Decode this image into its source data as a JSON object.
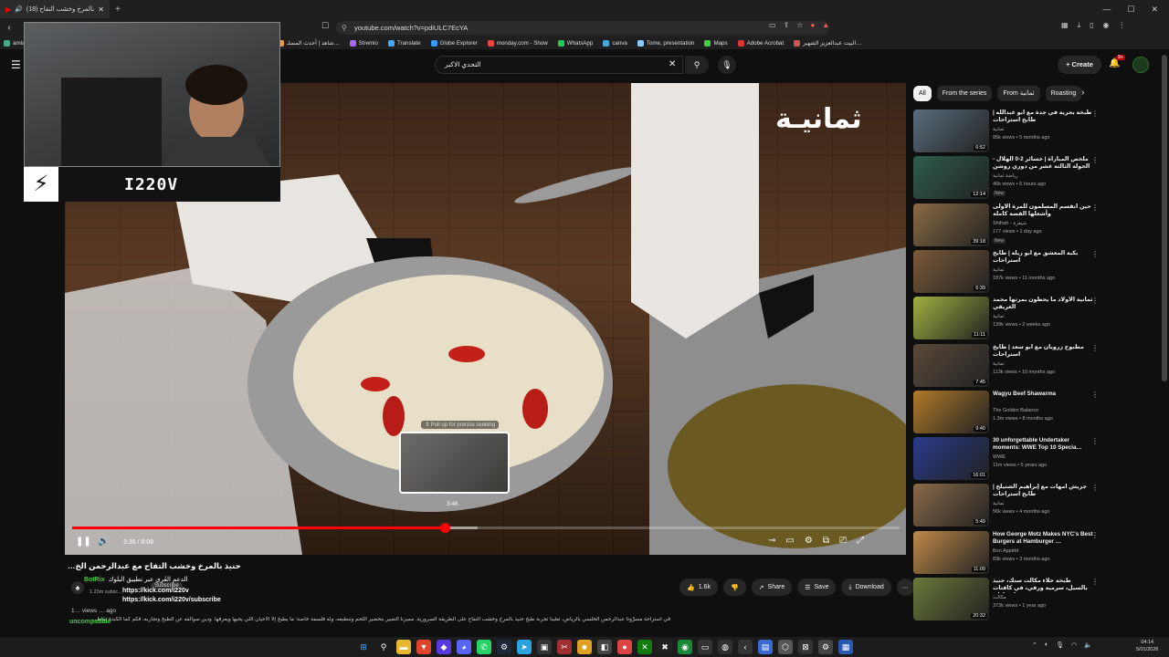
{
  "browser": {
    "tab_title": "(18) حنيذ بالمرخ وخشب التفاح",
    "tab_close": "✕",
    "new_tab": "+",
    "url": "youtube.com/watch?v=pdiULC7EcYA",
    "bookmarks": [
      "amla…",
      "ChatGPT",
      "اصوات مكسر",
      "DokanTIP - الرئيسية",
      "Speedtest by Ookla…",
      "شاهد | أحدث المسلـ…",
      "Stremio",
      "Translate",
      "Globe Explorer",
      "monday.com - Show",
      "WhatsApp",
      "canva",
      "Tome, presentation",
      "Maps",
      "Adobe Acrobat",
      "البيت عبدالعزيز الشهير…"
    ]
  },
  "header": {
    "search_query": "التحدي الاكبر",
    "create_label": "Create",
    "notif_badge": "9+"
  },
  "webcam": {
    "streamer_name": "I220V",
    "logo_glyph": "⚡"
  },
  "player": {
    "watermark": "ثمانيـة",
    "preview_hint": "⇕ Pull up for precise seeking",
    "preview_time": "3:46",
    "current_time": "3:36",
    "duration": "8:08",
    "timecode": "3:36 / 8:08",
    "progress_fraction": 0.45,
    "buffer_fraction": 0.49
  },
  "video_info": {
    "title": "حنيذ بالمرخ وخشب التفاح مع عبدالرحمن الخ…",
    "subscribers": "1.23m subsc…",
    "subscribe_label": "Subscribe",
    "description": "في استراحة مسرَّوتا عبدالرحمن الخلسي بالرياض، تعلينا تجربة طبخ حنيذ بالمرخ وخشب التفاح على الطريقة السرورية. مميزنا التعبير بتحضير اللحم وتنطيعه، وله فلسفة خاصة: ما يطبخ إلا الأحيان اللي يحبها ويعرفها. ودين سوالفه عن الطبخ وتجاربه، فكم كما الكبدة نقاط…",
    "views_line": "1… views … ago",
    "like_count": "1.6k",
    "share_label": "Share",
    "save_label": "Save",
    "download_label": "Download"
  },
  "chat": [
    {
      "user": "BotRix",
      "text": "الدعم العُري عبر تطبيق البلوك",
      "color": "#3ecf3e"
    },
    {
      "user": "",
      "text": "https://kick.com/i220v",
      "color": "#ffffff"
    },
    {
      "user": "",
      "text": "https://kick.com/i220v/subscribe",
      "color": "#ffffff"
    },
    {
      "user": "uncompatible",
      "text": "",
      "color": "#3ecf3e"
    }
  ],
  "chips": [
    "All",
    "From the series",
    "From ثمانية",
    "Roasting"
  ],
  "recommendations": [
    {
      "title": "طبخة بحرية في جدة مع أبو عبدالله | طابخ استراحات",
      "channel": "ثمانية",
      "meta": "95k views • 5 months ago",
      "duration": "6:52",
      "badge": "",
      "thumb": "#5a6e7c"
    },
    {
      "title": "ملخص المباراة | خسائر 2-0 الهلال - الجولة الثالثة عشر من دوري روشن",
      "channel": "رياضة ثمانية",
      "meta": "46k views • 5 hours ago",
      "duration": "12:14",
      "badge": "New",
      "thumb": "#2e5d4a"
    },
    {
      "title": "حين انقسم المسلمون للمرة الأولى وأشعلها القصة كاملة",
      "channel": "Shifrah - شيفرة",
      "meta": "177 views • 1 day ago",
      "duration": "39:18",
      "badge": "New",
      "thumb": "#8a6c44"
    },
    {
      "title": "بكبة المعشق مع أبو زيلة | طابخ استراحات",
      "channel": "ثمانية",
      "meta": "187k views • 11 months ago",
      "duration": "6:39",
      "badge": "",
      "thumb": "#7b5a3a"
    },
    {
      "title": "ثمانية الأولاد ما يحطون بمرتها محمد الغريقي",
      "channel": "ثمانية",
      "meta": "139k views • 2 weeks ago",
      "duration": "11:11",
      "badge": "",
      "thumb": "#a0b040"
    },
    {
      "title": "مطبوخ زرويان مع أبو سعد | طابخ استراحات",
      "channel": "ثمانية",
      "meta": "113k views • 10 months ago",
      "duration": "7:45",
      "badge": "",
      "thumb": "#5a4a3a"
    },
    {
      "title": "Wagyu Beef Shawarma",
      "channel": "The Golden Balance",
      "meta": "1.3m views • 8 months ago",
      "duration": "9:40",
      "badge": "",
      "thumb": "#b07a2a"
    },
    {
      "title": "30 unforgettable Undertaker moments: WWE Top 10 Specia…",
      "channel": "WWE",
      "meta": "11m views • 5 years ago",
      "duration": "16:01",
      "badge": "",
      "thumb": "#2a3a8a"
    },
    {
      "title": "جريش أمهات مع إبراهيم الشتيلخ | طابخ استراحات",
      "channel": "ثمانية",
      "meta": "56k views • 4 months ago",
      "duration": "5:49",
      "badge": "",
      "thumb": "#8a6a4a"
    },
    {
      "title": "How George Motz Makes NYC's Best Burgers at Hamburger …",
      "channel": "Bon Appétit",
      "meta": "83k views • 3 months ago",
      "duration": "11:09",
      "badge": "",
      "thumb": "#c08a4a"
    },
    {
      "title": "طبخة حلاء مكالت سنك، حنيذ بالسيل، سرمية ورقي، في كافتات حول جازان",
      "channel": "مكالت",
      "meta": "373k views • 1 year ago",
      "duration": "20:32",
      "badge": "",
      "thumb": "#6a7a3a"
    }
  ],
  "taskbar": {
    "time": "04:14",
    "date": "5/01/2026"
  }
}
